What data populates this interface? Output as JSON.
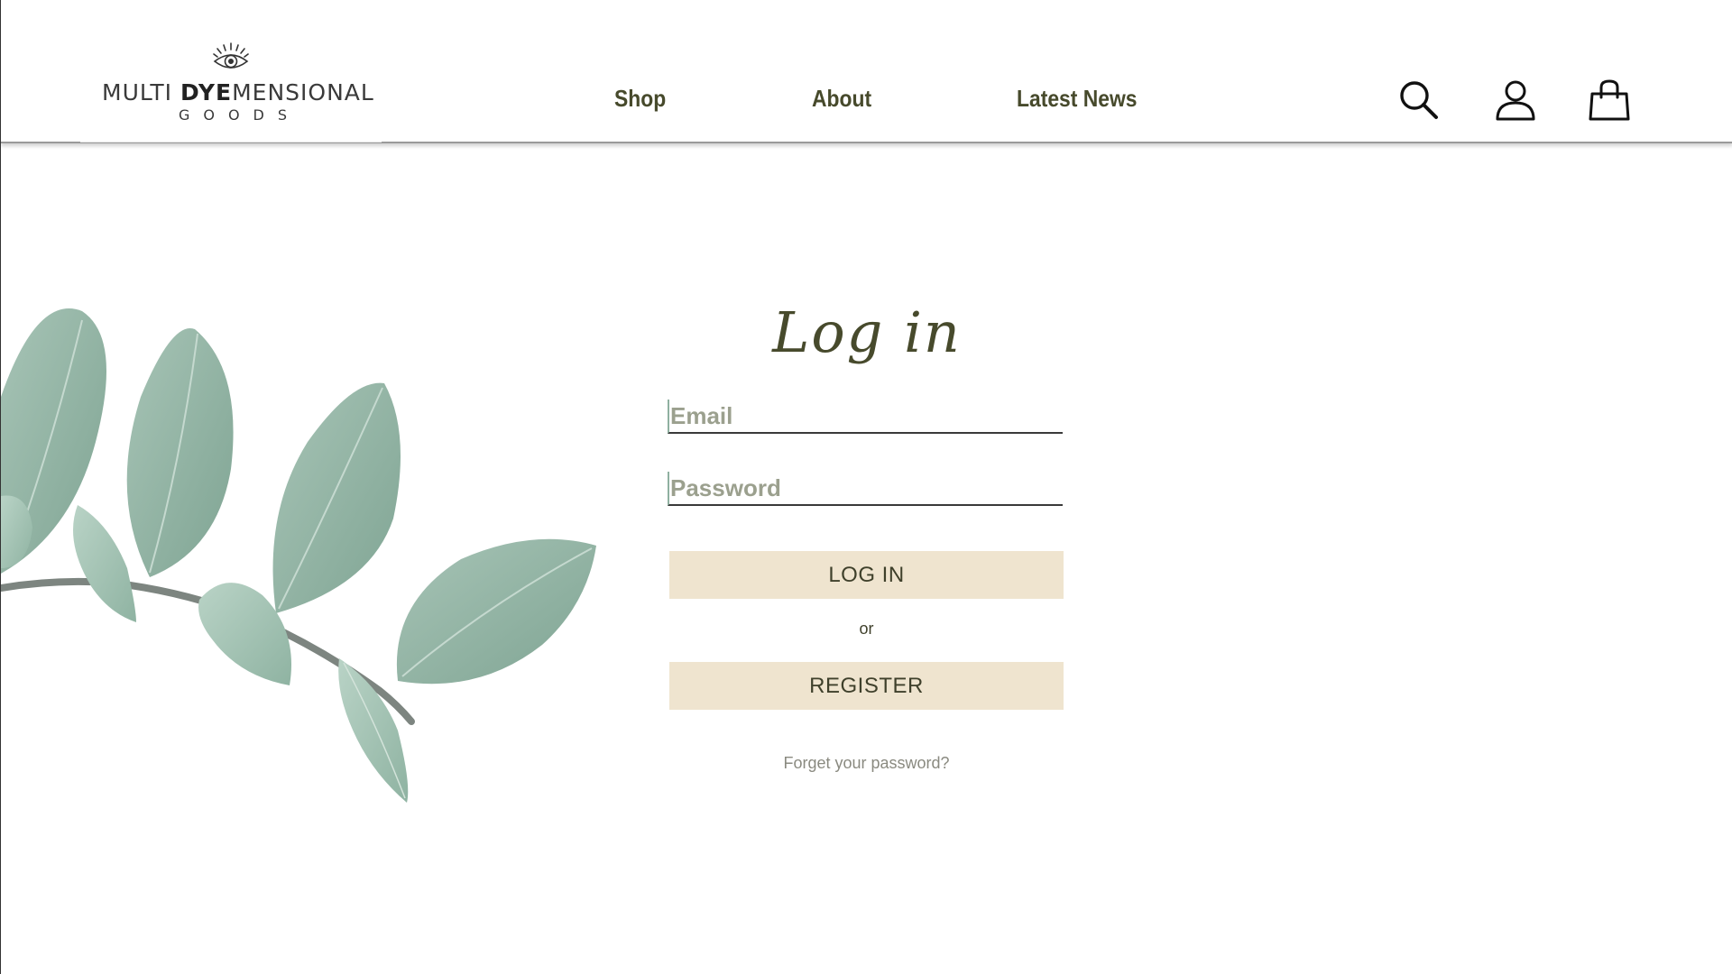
{
  "brand": {
    "line1_left": "MULTI",
    "line1_bold": "DYE",
    "line1_right": "MENSIONAL",
    "line2": "GOODS"
  },
  "nav": {
    "items": [
      {
        "label": "Shop"
      },
      {
        "label": "About"
      },
      {
        "label": "Latest News"
      }
    ]
  },
  "header_icons": [
    "search-icon",
    "account-icon",
    "shopping-bag-icon"
  ],
  "login": {
    "title": "Log in",
    "email_placeholder": "Email",
    "email_value": "",
    "password_placeholder": "Password",
    "password_value": "",
    "login_button": "LOG IN",
    "or_text": "or",
    "register_button": "REGISTER",
    "forgot_link": "Forget your password?"
  },
  "colors": {
    "accent_text": "#474a2c",
    "button_bg": "#efe4cf",
    "leaf_green": "#8fb4a3",
    "background": "#ffffff"
  }
}
